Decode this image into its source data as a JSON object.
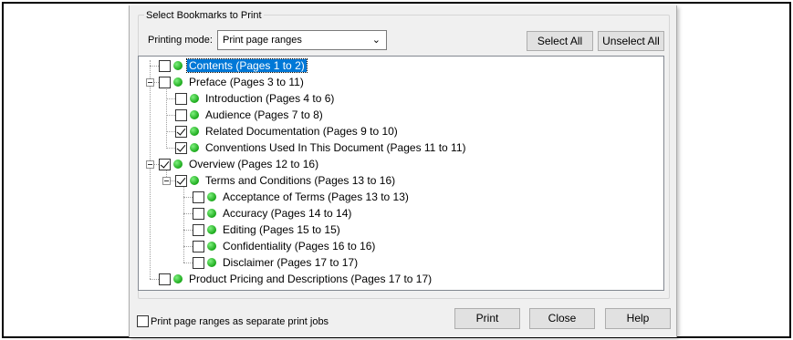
{
  "group_title": "Select Bookmarks to Print",
  "printing_mode": {
    "label": "Printing mode:",
    "selected": "Print page ranges"
  },
  "buttons": {
    "select_all": "Select All",
    "unselect_all": "Unselect All",
    "print": "Print",
    "close": "Close",
    "help": "Help"
  },
  "tree": [
    {
      "label": "Contents (Pages 1 to 2)",
      "checked": false,
      "selected": true
    },
    {
      "label": "Preface (Pages 3 to 11)",
      "checked": false
    },
    {
      "label": "Introduction (Pages 4 to 6)",
      "checked": false
    },
    {
      "label": "Audience (Pages 7 to 8)",
      "checked": false
    },
    {
      "label": "Related Documentation (Pages 9 to 10)",
      "checked": true
    },
    {
      "label": "Conventions Used In This Document (Pages 11 to 11)",
      "checked": true
    },
    {
      "label": "Overview (Pages 12 to 16)",
      "checked": true
    },
    {
      "label": "Terms and Conditions (Pages 13 to 16)",
      "checked": true
    },
    {
      "label": "Acceptance of Terms (Pages 13 to 13)",
      "checked": false
    },
    {
      "label": "Accuracy (Pages 14 to 14)",
      "checked": false
    },
    {
      "label": "Editing (Pages 15 to 15)",
      "checked": false
    },
    {
      "label": "Confidentiality (Pages 16 to 16)",
      "checked": false
    },
    {
      "label": "Disclaimer (Pages 17 to 17)",
      "checked": false
    },
    {
      "label": "Product Pricing and Descriptions (Pages 17 to 17)",
      "checked": false
    }
  ],
  "separate_jobs": {
    "label": "Print page ranges as separate print jobs",
    "checked": false
  },
  "colors": {
    "selection": "#0078d7",
    "status_dot": "#1aa81a"
  }
}
